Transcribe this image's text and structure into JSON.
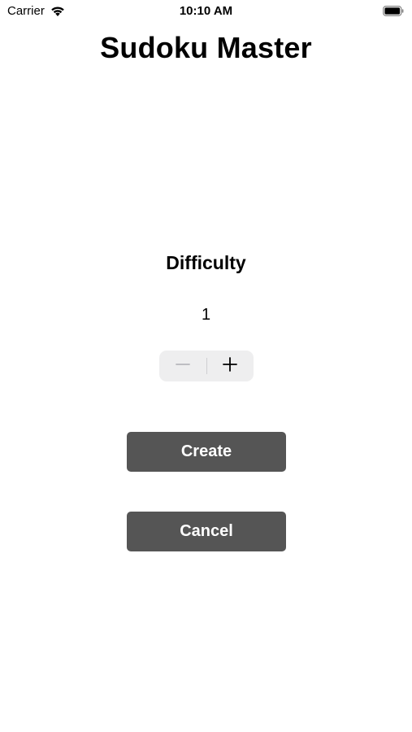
{
  "status_bar": {
    "carrier": "Carrier",
    "time": "10:10 AM",
    "wifi_icon": "wifi-icon",
    "battery_icon": "battery-icon"
  },
  "app": {
    "title": "Sudoku Master"
  },
  "difficulty": {
    "label": "Difficulty",
    "value": "1",
    "decrement_icon": "minus-icon",
    "increment_icon": "plus-icon"
  },
  "actions": {
    "create_label": "Create",
    "cancel_label": "Cancel"
  },
  "colors": {
    "button_bg": "#555555",
    "stepper_bg": "#eeeeef"
  }
}
